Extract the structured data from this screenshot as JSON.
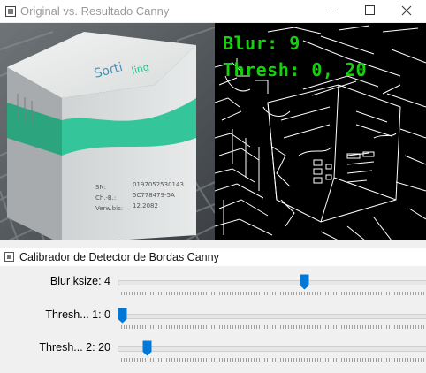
{
  "main_window": {
    "title": "Original vs. Resultado Canny",
    "overlay": {
      "line1": "Blur: 9",
      "line2": "Thresh: 0, 20",
      "color": "#16d00f"
    },
    "original_image": {
      "box_text": {
        "brand": "Sorti",
        "sn_label": "SN:",
        "sn_value": "0197052530143",
        "ch_label": "Ch.-B.:",
        "ch_value": "5C778479-5A",
        "verw_label": "Verw.bis:",
        "verw_value": "12.2082"
      }
    }
  },
  "controls_window": {
    "title": "Calibrador de Detector de Bordas Canny",
    "sliders": [
      {
        "label": "Blur ksize: 4",
        "value": 4,
        "max": 7
      },
      {
        "label": "Thresh... 1: 0",
        "value": 0,
        "max": 255
      },
      {
        "label": "Thresh... 2: 20",
        "value": 20,
        "max": 255
      }
    ]
  },
  "colors": {
    "accent": "#0078d7",
    "titlebar": "#ffffff",
    "panel_bg": "#f0f0f0"
  }
}
